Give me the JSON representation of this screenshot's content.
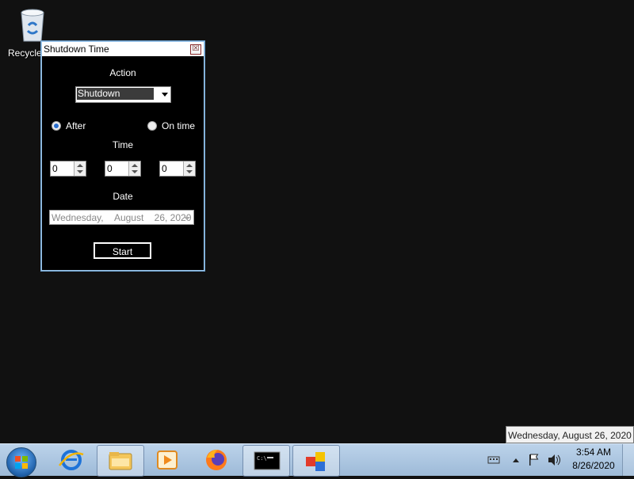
{
  "desktop": {
    "recycle_label": "Recycle"
  },
  "window": {
    "title": "Shutdown Time",
    "close_glyph": "☒",
    "action_label": "Action",
    "action_value": "Shutdown",
    "radio_after": "After",
    "radio_on_time": "On time",
    "time_label": "Time",
    "hours": "0",
    "minutes": "0",
    "seconds": "0",
    "date_label": "Date",
    "date_weekday": "Wednesday,",
    "date_month": "August",
    "date_daynum": "26, 2020",
    "start_label": "Start"
  },
  "tooltip": "Wednesday, August 26, 2020",
  "taskbar": {
    "time": "3:54 AM",
    "date": "8/26/2020"
  }
}
